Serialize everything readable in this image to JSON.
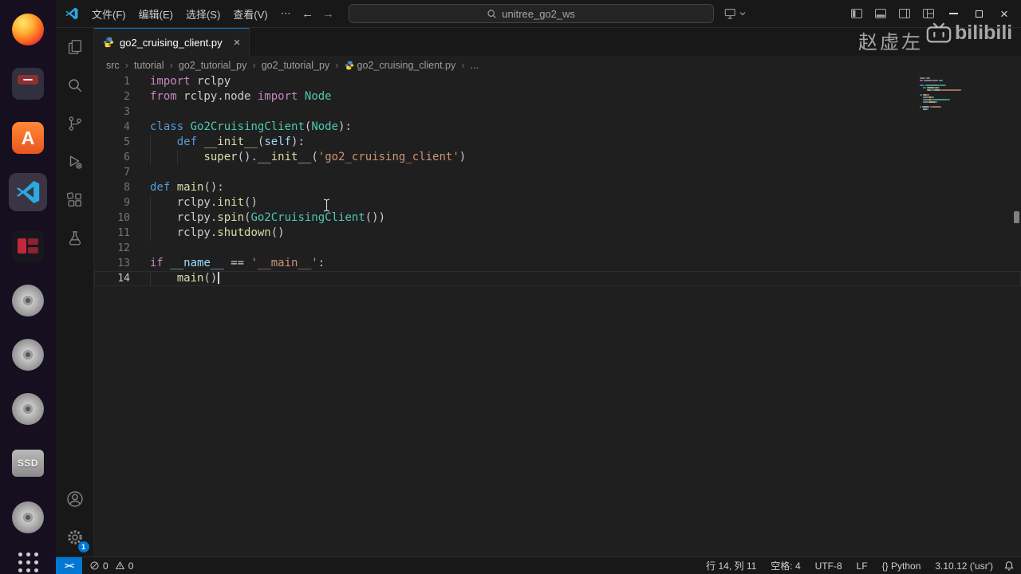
{
  "titlebar": {
    "menus": [
      "文件(F)",
      "编辑(E)",
      "选择(S)",
      "查看(V)",
      "⋯"
    ],
    "search_value": "unitree_go2_ws",
    "back_arrow": "←",
    "forward_arrow": "→"
  },
  "watermarks": {
    "name": "赵虚左",
    "brand": "bilibili"
  },
  "dock": {
    "items": [
      "firefox",
      "files-app",
      "software-app",
      "vscode",
      "media-app",
      "disk-1",
      "disk-2",
      "disk-3",
      "ssd-drive",
      "disk-4",
      "show-apps"
    ],
    "ssd_label": "SSD"
  },
  "activity_bar": {
    "icons": [
      "explorer",
      "search",
      "source-control",
      "run-debug",
      "extensions",
      "testing",
      "account",
      "settings"
    ],
    "settings_badge": "1"
  },
  "tab": {
    "label": "go2_cruising_client.py",
    "close": "×"
  },
  "breadcrumbs": [
    {
      "label": "src"
    },
    {
      "label": "tutorial"
    },
    {
      "label": "go2_tutorial_py"
    },
    {
      "label": "go2_tutorial_py"
    },
    {
      "label": "go2_cruising_client.py",
      "icon": "python"
    },
    {
      "label": "..."
    }
  ],
  "editor": {
    "cursor_line": 14,
    "lines": [
      {
        "tokens": [
          [
            "kc",
            "import"
          ],
          [
            "pl",
            " rclpy"
          ]
        ]
      },
      {
        "tokens": [
          [
            "kc",
            "from"
          ],
          [
            "pl",
            " rclpy.node "
          ],
          [
            "kc",
            "import"
          ],
          [
            "pl",
            " "
          ],
          [
            "ty",
            "Node"
          ]
        ]
      },
      {
        "tokens": []
      },
      {
        "tokens": [
          [
            "kd",
            "class"
          ],
          [
            "pl",
            " "
          ],
          [
            "ty",
            "Go2CruisingClient"
          ],
          [
            "pl",
            "("
          ],
          [
            "ty",
            "Node"
          ],
          [
            "pl",
            "):"
          ]
        ]
      },
      {
        "tokens": [
          [
            "pl",
            "    "
          ],
          [
            "kd",
            "def"
          ],
          [
            "pl",
            " "
          ],
          [
            "fn",
            "__init__"
          ],
          [
            "pl",
            "("
          ],
          [
            "va",
            "self"
          ],
          [
            "pl",
            "):"
          ]
        ],
        "guides": [
          0
        ]
      },
      {
        "tokens": [
          [
            "pl",
            "        "
          ],
          [
            "fn",
            "super"
          ],
          [
            "pl",
            "()."
          ],
          [
            "fn",
            "__init__"
          ],
          [
            "pl",
            "("
          ],
          [
            "st",
            "'go2_cruising_client'"
          ],
          [
            "pl",
            ")"
          ]
        ],
        "guides": [
          0,
          4
        ]
      },
      {
        "tokens": []
      },
      {
        "tokens": [
          [
            "kd",
            "def"
          ],
          [
            "pl",
            " "
          ],
          [
            "fn",
            "main"
          ],
          [
            "pl",
            "():"
          ]
        ]
      },
      {
        "tokens": [
          [
            "pl",
            "    rclpy."
          ],
          [
            "fn",
            "init"
          ],
          [
            "pl",
            "()"
          ]
        ],
        "guides": [
          0
        ]
      },
      {
        "tokens": [
          [
            "pl",
            "    rclpy."
          ],
          [
            "fn",
            "spin"
          ],
          [
            "pl",
            "("
          ],
          [
            "ty",
            "Go2CruisingClient"
          ],
          [
            "pl",
            "())"
          ]
        ],
        "guides": [
          0
        ]
      },
      {
        "tokens": [
          [
            "pl",
            "    rclpy."
          ],
          [
            "fn",
            "shutdown"
          ],
          [
            "pl",
            "()"
          ]
        ],
        "guides": [
          0
        ]
      },
      {
        "tokens": []
      },
      {
        "tokens": [
          [
            "kc",
            "if"
          ],
          [
            "pl",
            " "
          ],
          [
            "va",
            "__name__"
          ],
          [
            "pl",
            " == "
          ],
          [
            "st",
            "'__main__'"
          ],
          [
            "pl",
            ":"
          ]
        ]
      },
      {
        "tokens": [
          [
            "pl",
            "    "
          ],
          [
            "fn",
            "main"
          ],
          [
            "pl",
            "()"
          ]
        ],
        "guides": [
          0
        ]
      }
    ]
  },
  "status_bar": {
    "errors": "0",
    "warnings": "0",
    "items": [
      "行 14, 列 11",
      "空格: 4",
      "UTF-8",
      "LF",
      "{} Python",
      "3.10.12 ('usr')"
    ]
  },
  "colors": {
    "accent_blue": "#0078d4",
    "keyword_control": "#C586C0",
    "keyword_decl": "#569CD6",
    "type": "#4EC9B0",
    "function": "#DCDCAA",
    "string": "#CE9178",
    "variable": "#9CDCFE",
    "plain": "#CCCCCC"
  }
}
